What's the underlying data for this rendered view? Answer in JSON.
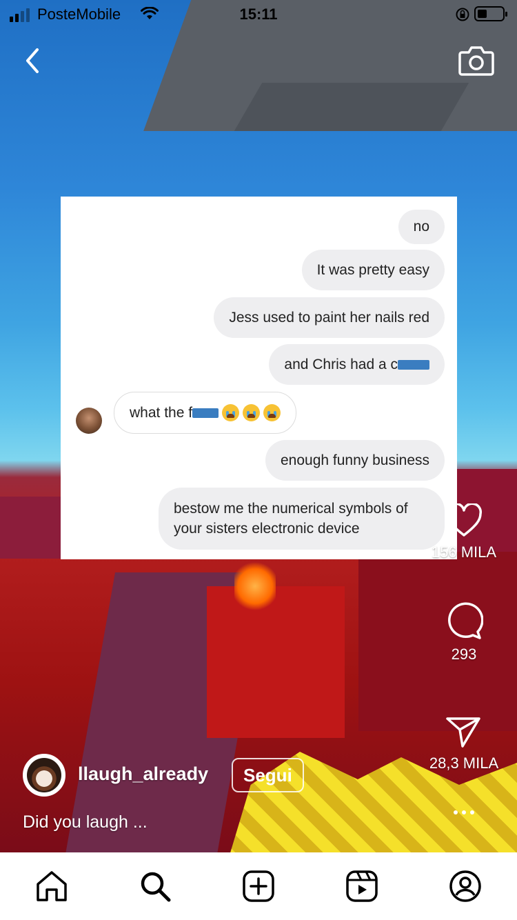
{
  "status_bar": {
    "carrier": "PosteMobile",
    "time": "15:11"
  },
  "top_bar": {
    "back_icon": "chevron-left-icon",
    "camera_icon": "camera-icon"
  },
  "chat": {
    "messages": [
      {
        "text": "no",
        "side": "right"
      },
      {
        "text": "It was pretty easy",
        "side": "right"
      },
      {
        "text": "Jess used to paint her nails red",
        "side": "right"
      },
      {
        "text": "and Chris had a c",
        "side": "right",
        "censored": true
      },
      {
        "text": "what the f",
        "side": "left",
        "censored": true,
        "emoji": "loudly-crying-face x3"
      },
      {
        "text": "enough funny business",
        "side": "right"
      },
      {
        "text": "bestow me the numerical symbols of your sisters electronic device",
        "side": "right"
      }
    ]
  },
  "actions": {
    "likes": "156 MILA",
    "comments": "293",
    "shares": "28,3 MILA"
  },
  "author": {
    "username": "llaugh_already",
    "follow_label": "Segui",
    "caption": "Did you laugh ..."
  },
  "nav": {
    "items": [
      "home-icon",
      "search-icon",
      "create-icon",
      "reels-icon",
      "profile-icon"
    ]
  },
  "colors": {
    "censor_blue": "#3a7dc0",
    "bubble_grey": "#eeeef0"
  }
}
